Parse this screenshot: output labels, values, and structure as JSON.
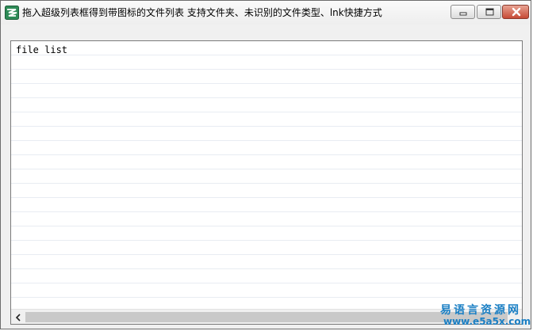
{
  "window": {
    "title": "拖入超级列表框得到带图标的文件列表 支持文件夹、未识别的文件类型、lnk快捷方式",
    "app_icon": "easy-language-icon",
    "caption_buttons": {
      "minimize_icon": "minimize-icon",
      "maximize_icon": "maximize-icon",
      "close_icon": "close-icon"
    }
  },
  "listbox": {
    "header_text": "file list",
    "row_count_visible": 18
  },
  "scrollbar": {
    "left_arrow": "<"
  },
  "watermark": {
    "cn": "易语言资源网",
    "en": "www.e5a5x.com"
  },
  "colors": {
    "watermark": "#1a7fc4",
    "close_button": "#c74a35"
  }
}
